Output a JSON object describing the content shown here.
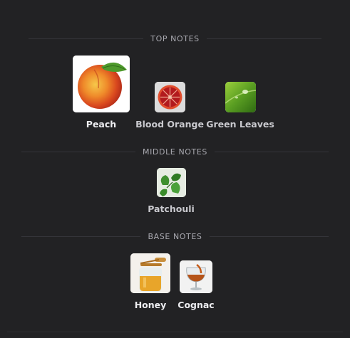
{
  "sections": {
    "top": {
      "title": "TOP NOTES",
      "notes": [
        {
          "label": "Peach",
          "icon": "peach-image"
        },
        {
          "label": "Blood Orange",
          "icon": "blood-orange-image"
        },
        {
          "label": "Green Leaves",
          "icon": "green-leaves-image"
        }
      ]
    },
    "middle": {
      "title": "MIDDLE NOTES",
      "notes": [
        {
          "label": "Patchouli",
          "icon": "patchouli-image"
        }
      ]
    },
    "base": {
      "title": "BASE NOTES",
      "notes": [
        {
          "label": "Honey",
          "icon": "honey-image"
        },
        {
          "label": "Cognac",
          "icon": "cognac-image"
        }
      ]
    }
  },
  "colors": {
    "background": "#222224",
    "heading": "#a9a9b0",
    "label": "#c9c9ce",
    "divider": "#35353a"
  }
}
